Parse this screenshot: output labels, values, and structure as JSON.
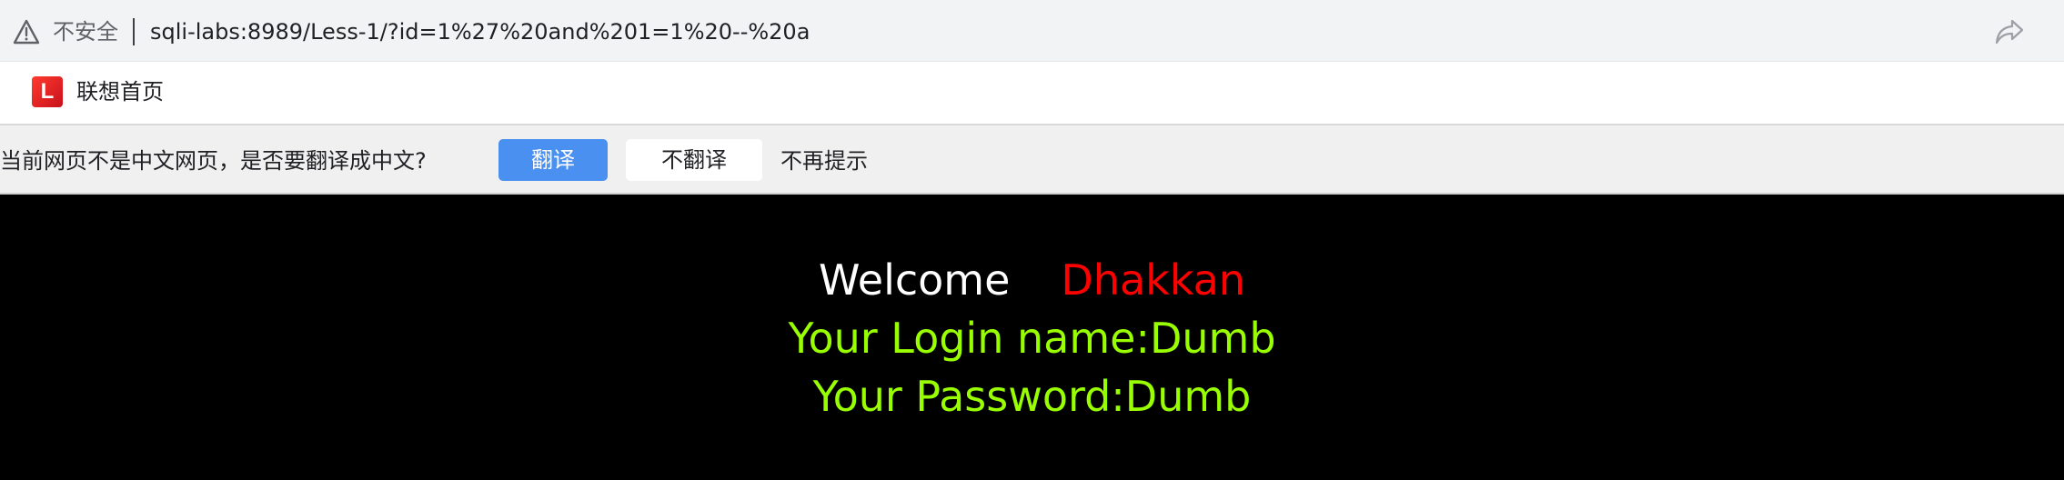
{
  "address_bar": {
    "insecure_label": "不安全",
    "url": "sqli-labs:8989/Less-1/?id=1%27%20and%201=1%20--%20a",
    "icons": [
      "warning-icon",
      "share-icon"
    ]
  },
  "bookmarks": {
    "items": [
      {
        "label": "联想首页",
        "icon": "lenovo-icon",
        "icon_letter": "L"
      }
    ]
  },
  "translate_bar": {
    "prompt": "当前网页不是中文网页，是否要翻译成中文?",
    "translate_button": "翻译",
    "no_translate_button": "不翻译",
    "never_prompt": "不再提示"
  },
  "page": {
    "welcome": "Welcome",
    "welcome_name": "Dhakkan",
    "login_line": "Your Login name:Dumb",
    "password_line": "Your Password:Dumb"
  },
  "colors": {
    "page_background": "#000000",
    "welcome_text": "#ffffff",
    "name_text": "#ff0000",
    "result_text": "#99ff00",
    "translate_button": "#4a90f0"
  }
}
